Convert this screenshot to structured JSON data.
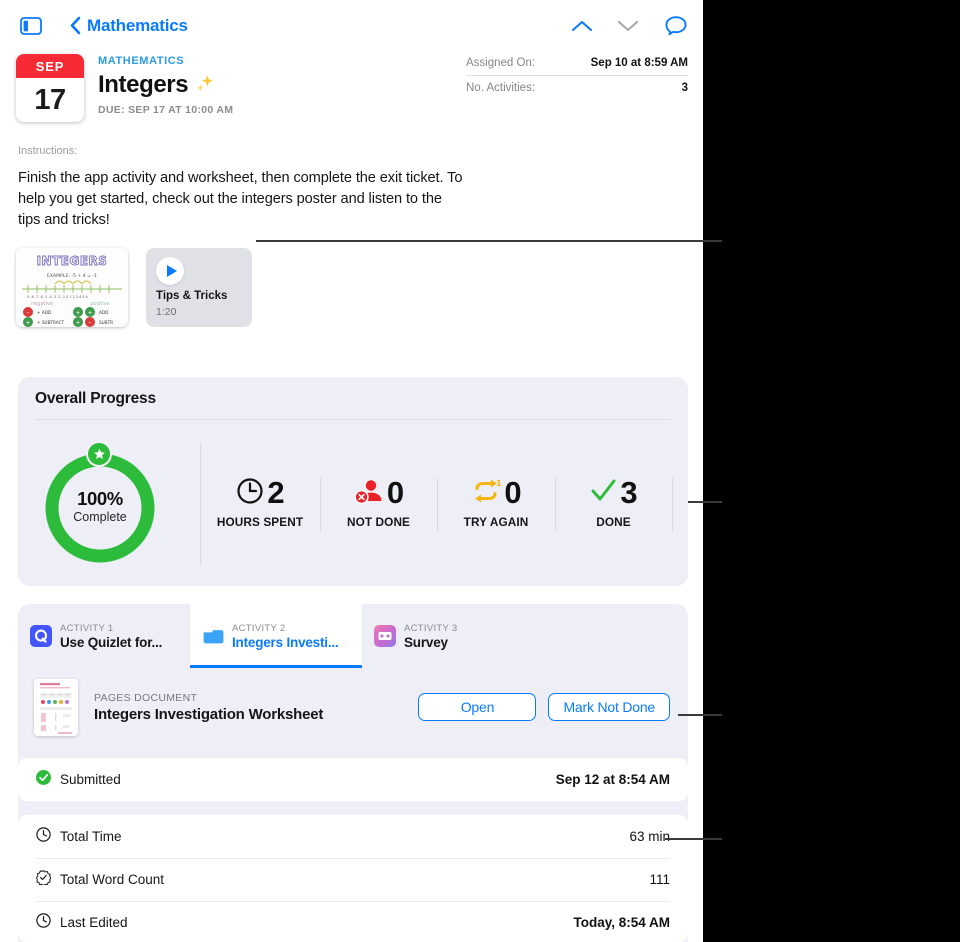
{
  "navbar": {
    "sidebar_toggle_icon": "sidebar-icon",
    "back_chevron_icon": "chevron-left-icon",
    "back_label": "Mathematics",
    "up_icon": "chevron-up-icon",
    "down_icon": "chevron-down-icon",
    "comment_icon": "comment-bubble-icon"
  },
  "header": {
    "calendar": {
      "month": "SEP",
      "day": "17"
    },
    "subject": "MATHEMATICS",
    "title": "Integers",
    "title_emoji_icon": "sparkles-icon",
    "due": "DUE: SEP 17 AT 10:00 AM"
  },
  "meta": {
    "rows": [
      {
        "key": "Assigned On:",
        "value": "Sep 10 at 8:59 AM"
      },
      {
        "key": "No. Activities:",
        "value": "3"
      }
    ]
  },
  "instructions": {
    "label": "Instructions:",
    "body": "Finish the app activity and worksheet, then complete the exit ticket. To help you get started, check out the integers poster and listen to the tips and tricks!"
  },
  "attachments": {
    "poster": {
      "icon": "image-thumbnail-icon",
      "heading": "INTEGERS",
      "example": "EXAMPLE: -5 + 4 = -1",
      "left_axis_label": "negative",
      "right_axis_label": "positive",
      "legend": [
        {
          "sign": "-",
          "op": "ADD"
        },
        {
          "sign": "+",
          "op": "ADD"
        },
        {
          "sign": "+",
          "op": "SUBTRACT"
        },
        {
          "sign": "-",
          "op": "SUBTRACT"
        }
      ]
    },
    "video": {
      "play_icon": "play-icon",
      "title": "Tips & Tricks",
      "duration": "1:20"
    }
  },
  "progress": {
    "title": "Overall Progress",
    "ring": {
      "percent": "100%",
      "sub": "Complete",
      "value": 100,
      "color": "#2cbb3a",
      "badge_icon": "star-badge-icon"
    },
    "stats": [
      {
        "icon": "clock-icon",
        "value": "2",
        "label": "HOURS SPENT",
        "color": "#111111"
      },
      {
        "icon": "person-x-icon",
        "value": "0",
        "label": "NOT DONE",
        "color": "#ea2027"
      },
      {
        "icon": "loop-arrows-icon",
        "value": "0",
        "label": "TRY AGAIN",
        "color": "#f5b614"
      },
      {
        "icon": "checkmark-icon",
        "value": "3",
        "label": "DONE",
        "color": "#2cbb3a"
      }
    ]
  },
  "activities": {
    "tabs": [
      {
        "kicker": "ACTIVITY 1",
        "name": "Use Quizlet for...",
        "icon": "quizlet-app-icon",
        "active": false
      },
      {
        "kicker": "ACTIVITY 2",
        "name": "Integers Investi...",
        "icon": "folder-icon",
        "active": true
      },
      {
        "kicker": "ACTIVITY 3",
        "name": "Survey",
        "icon": "survey-app-icon",
        "active": false
      }
    ],
    "document": {
      "thumbnail_icon": "pages-document-thumbnail",
      "kicker": "PAGES DOCUMENT",
      "title": "Integers Investigation Worksheet",
      "open_label": "Open",
      "mark_label": "Mark Not Done"
    },
    "submitted": {
      "icon": "check-circle-icon",
      "label": "Submitted",
      "value": "Sep 12 at 8:54 AM"
    },
    "stats_rows": [
      {
        "icon": "clock-icon",
        "label": "Total Time",
        "value": "63 min",
        "bold": false
      },
      {
        "icon": "seal-check-icon",
        "label": "Total Word Count",
        "value": "111",
        "bold": false
      },
      {
        "icon": "clock-icon",
        "label": "Last Edited",
        "value": "Today, 8:54 AM",
        "bold": true
      }
    ]
  },
  "colors": {
    "accent_blue": "#0a7bff",
    "red": "#f62b35",
    "green": "#2cbb3a",
    "yellow": "#f5b614",
    "card_bg": "#eeeef6"
  }
}
